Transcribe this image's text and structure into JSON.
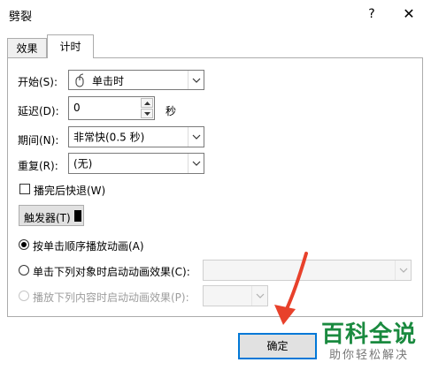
{
  "window": {
    "title": "劈裂",
    "help": "?",
    "close": "✕"
  },
  "tabs": [
    {
      "label": "效果"
    },
    {
      "label": "计时"
    }
  ],
  "timing": {
    "start_label": "开始(S):",
    "start_value": "单击时",
    "delay_label": "延迟(D):",
    "delay_value": "0",
    "delay_unit": "秒",
    "duration_label": "期间(N):",
    "duration_value": "非常快(0.5 秒)",
    "repeat_label": "重复(R):",
    "repeat_value": "(无)",
    "rewind_label": "播完后快退(W)",
    "rewind_checked": false,
    "trigger_label": "触发器(T)"
  },
  "triggers": {
    "option1": "按单击顺序播放动画(A)",
    "option2": "单击下列对象时启动动画效果(C):",
    "option3": "播放下列内容时启动动画效果(P):",
    "selected": 0
  },
  "buttons": {
    "ok": "确定"
  },
  "watermark": {
    "title": "百科全说",
    "subtitle": "助你轻松解决"
  },
  "colors": {
    "accent_arrow": "#e8412b",
    "watermark": "#1a8a3f"
  }
}
